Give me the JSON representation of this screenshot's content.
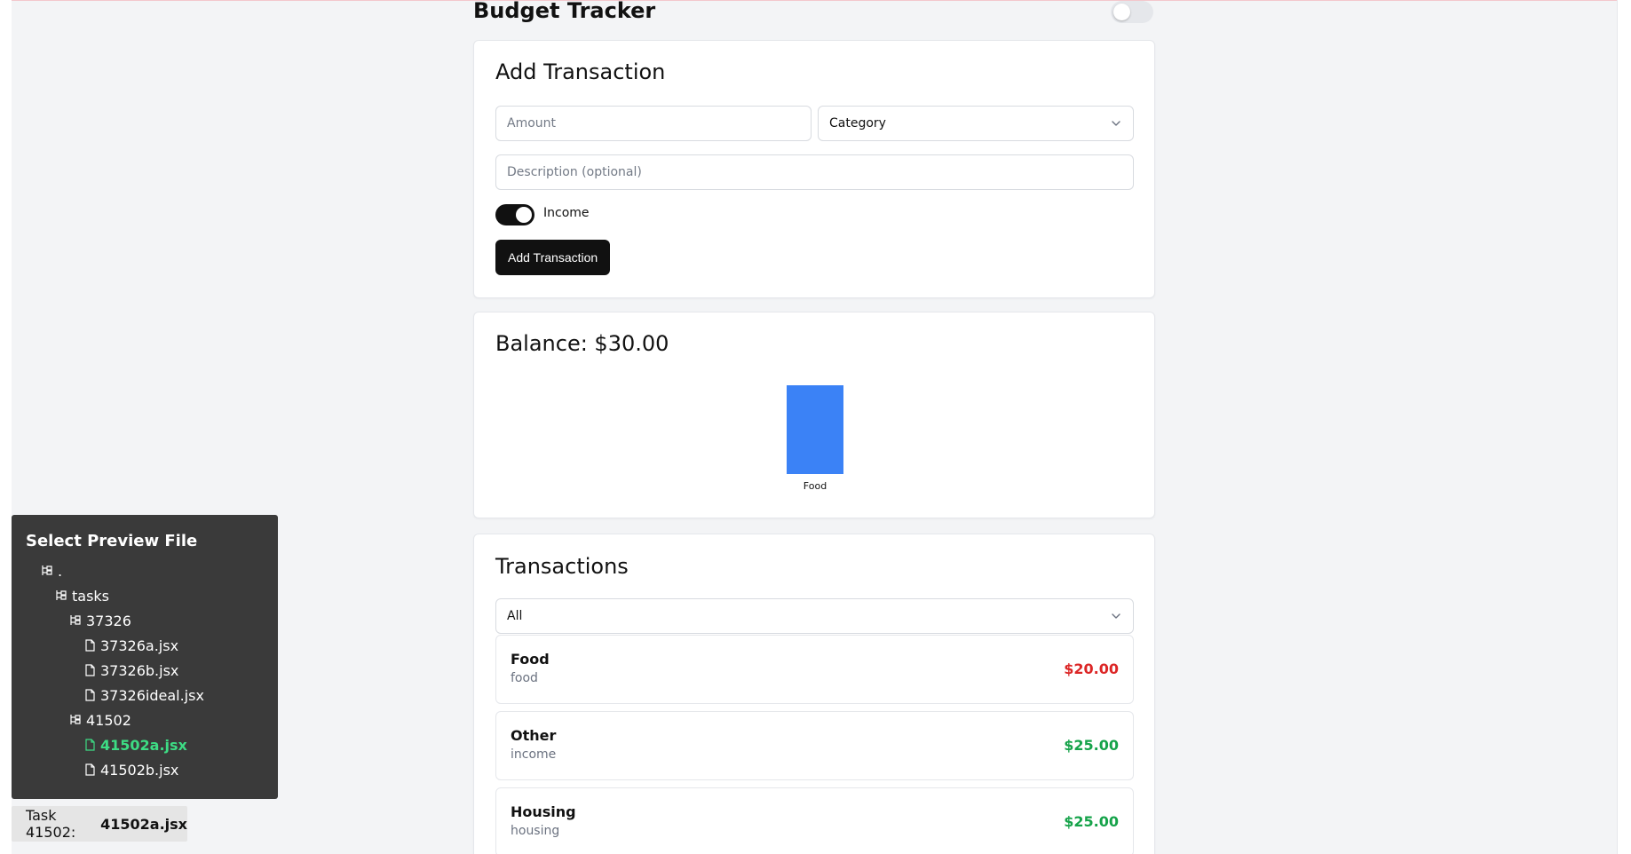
{
  "app": {
    "title": "Budget Tracker"
  },
  "add_transaction": {
    "title": "Add Transaction",
    "amount_placeholder": "Amount",
    "category_value": "Category",
    "description_placeholder": "Description (optional)",
    "income_label": "Income",
    "income_on": true,
    "submit_label": "Add Transaction"
  },
  "balance": {
    "label": "Balance: $30.00"
  },
  "chart_data": {
    "type": "bar",
    "categories": [
      "Food"
    ],
    "values": [
      20
    ],
    "colors": [
      "#3b82f6"
    ]
  },
  "transactions": {
    "title": "Transactions",
    "filter_value": "All",
    "items": [
      {
        "category": "Food",
        "description": "food",
        "amount": "$20.00",
        "kind": "expense"
      },
      {
        "category": "Other",
        "description": "income",
        "amount": "$25.00",
        "kind": "income"
      },
      {
        "category": "Housing",
        "description": "housing",
        "amount": "$25.00",
        "kind": "income"
      }
    ]
  },
  "file_panel": {
    "title": "Select Preview File",
    "tree": [
      {
        "label": ".",
        "type": "folder"
      },
      {
        "label": "tasks",
        "type": "folder"
      },
      {
        "label": "37326",
        "type": "folder"
      },
      {
        "label": "37326a.jsx",
        "type": "file"
      },
      {
        "label": "37326b.jsx",
        "type": "file"
      },
      {
        "label": "37326ideal.jsx",
        "type": "file"
      },
      {
        "label": "41502",
        "type": "folder"
      },
      {
        "label": "41502a.jsx",
        "type": "file",
        "active": true
      },
      {
        "label": "41502b.jsx",
        "type": "file"
      }
    ]
  },
  "task_badge": {
    "prefix": "Task 41502:",
    "file": "41502a.jsx"
  },
  "colors": {
    "expense": "#dc2626",
    "income": "#16a34a",
    "bar": "#3b82f6",
    "active_file": "#3ddc84"
  }
}
